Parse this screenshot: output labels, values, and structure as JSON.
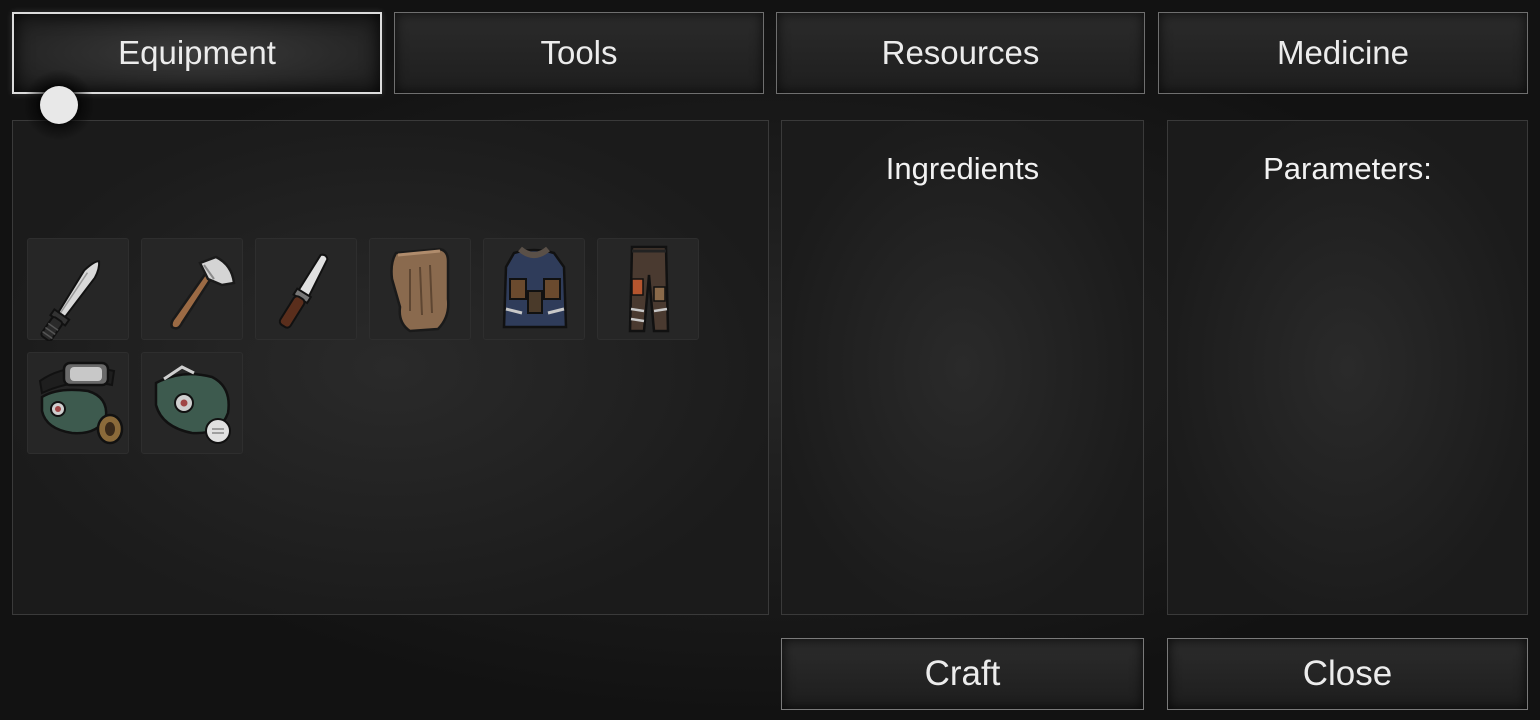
{
  "tabs": [
    {
      "label": "Equipment",
      "active": true
    },
    {
      "label": "Tools",
      "active": false
    },
    {
      "label": "Resources",
      "active": false
    },
    {
      "label": "Medicine",
      "active": false
    }
  ],
  "panels": {
    "ingredients_title": "Ingredients",
    "parameters_title": "Parameters:"
  },
  "items": [
    {
      "icon": "combat-knife-icon"
    },
    {
      "icon": "hatchet-icon"
    },
    {
      "icon": "kitchen-knife-icon"
    },
    {
      "icon": "work-gloves-icon"
    },
    {
      "icon": "tactical-vest-icon"
    },
    {
      "icon": "patched-pants-icon"
    },
    {
      "icon": "gas-mask-with-goggles-icon"
    },
    {
      "icon": "respirator-mask-icon"
    }
  ],
  "buttons": {
    "craft": "Craft",
    "close": "Close"
  },
  "colors": {
    "background": "#121212",
    "panel": "#1f1f1f",
    "border": "#6f6f6f",
    "text": "#ececec"
  }
}
